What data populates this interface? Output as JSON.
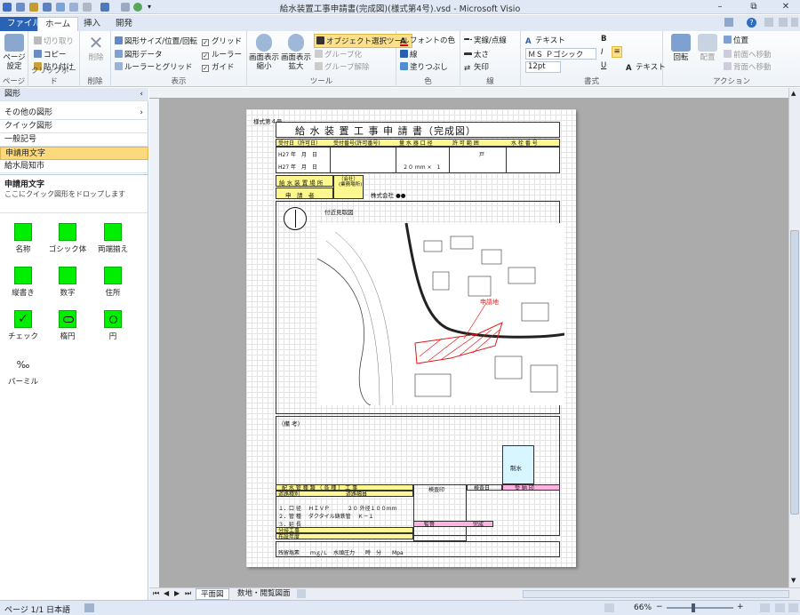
{
  "window": {
    "title": "給水装置工事申請書(完成図)(様式第4号).vsd - Microsoft Visio",
    "minimize": "–",
    "restore": "⧉",
    "close": "✕"
  },
  "tabs": [
    {
      "label": "ファイル"
    },
    {
      "label": "ホーム"
    },
    {
      "label": "挿入"
    },
    {
      "label": "開発"
    }
  ],
  "ribbon": {
    "page_setup": "ページ\n設定",
    "page_group": "ページ",
    "cut": "切り取り",
    "copy": "コピー",
    "paste": "貼り付け",
    "clipboard_group": "クリップボード",
    "delete": "削除",
    "delete_group": "削除",
    "shape_size": "図形サイズ/位置/回転",
    "shape_data": "図形データ",
    "ruler_grid": "ルーラーとグリッド",
    "grid": "グリッド",
    "ruler": "ルーラー",
    "guide": "ガイド",
    "display_group": "表示",
    "zoom_out": "画面表示\n縮小",
    "zoom_in": "画面表示\n拡大",
    "object_select": "オブジェクト選択ツール",
    "group": "グループ化",
    "ungroup": "グループ解除",
    "tool_group": "ツール",
    "font_color": "フォントの色",
    "line": "線",
    "fill": "塗りつぶし",
    "color_group": "色",
    "line_pattern": "実線/点線",
    "line_weight": "太さ",
    "arrow": "矢印",
    "line_group": "線",
    "text": "テキスト",
    "font_name": "ＭＳ Ｐゴシック",
    "font_size": "12pt",
    "text2": "テキスト",
    "format_group": "書式",
    "rotate": "回転",
    "align": "配置",
    "position": "位置",
    "bring_front": "前面へ移動",
    "send_back": "背面へ移動",
    "action_group": "アクション"
  },
  "left_panel": {
    "header": "図形",
    "more_shapes": "その他の図形",
    "quick_shapes": "クイック図形",
    "stencils": [
      "一般記号",
      "申請用文字",
      "給水局知市"
    ],
    "drop_title": "申請用文字",
    "drop_hint": "ここにクイック図形をドロップします",
    "items": [
      "名称",
      "ゴシック体",
      "両端揃え",
      "縦書き",
      "数字",
      "住所",
      "チェック",
      "楕円",
      "円",
      "パーミル"
    ]
  },
  "doc": {
    "form_no": "様式第４号",
    "title": "給 水 装 置 工 事 申 請 書（完成図）",
    "headers": [
      "受付日（許可日）",
      "受付番号(許可番号)",
      "量 水 器 口 径",
      "許 可 範 囲",
      "水 栓 番 号"
    ],
    "date1": "H27 年　月　日",
    "date2": "H27 年　月　日",
    "meter_size": "２０ mm ×　1",
    "dwelling": "戸",
    "site_label": "給 水 装 置 場 所",
    "applicant_label": "申　請　者",
    "applicant": "株式会社 ●●",
    "company": "（会社）\n(業務場所)",
    "furigana": "フリガナ\n氏　名",
    "map_label": "付近見取図",
    "request_site": "申請地",
    "notes": "（備 考）",
    "valve": "制水",
    "pipe_title": "配 水 管 種 類 （ 各 種 ） 工 事",
    "pipe_type": "道路種別",
    "road_width": "道路幅員",
    "rows": [
      "１．口 径　 ＨＩＶＰ　　　 ２０ 外径１００mm",
      "２．管 種　 ダクタイル鋳鉄管　 Ｋ－１",
      "３．延 長",
      "分岐工事",
      "布設年度"
    ],
    "water_pressure": "残留塩素　　ｍｇ/Ｌ　水頭圧力　　時　分　　Mpa",
    "approve": "検査印",
    "inspect": "監督",
    "accept": "受 納 印",
    "check1": "検査日",
    "check2": "完成"
  },
  "status": {
    "page": "ページ 1/1",
    "lang": "日本語",
    "sheet1": "平面図",
    "sheet2": "数地・閲覧図面",
    "zoom": "66%"
  }
}
